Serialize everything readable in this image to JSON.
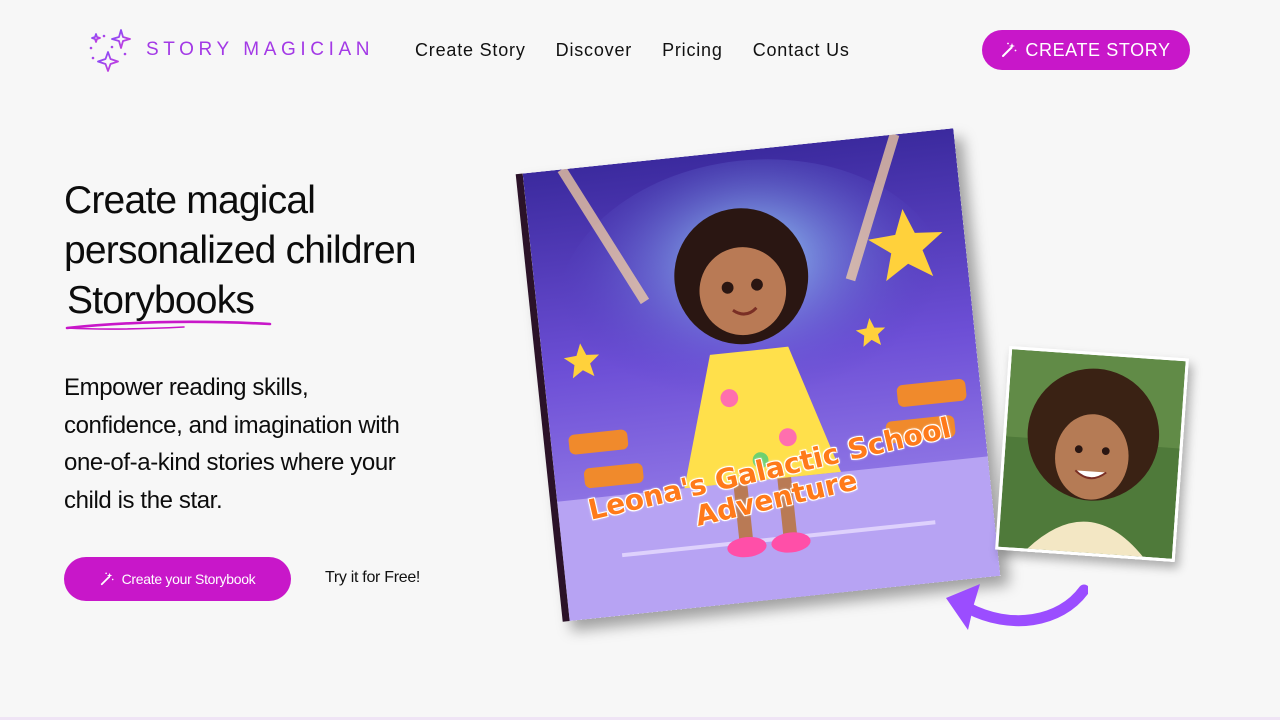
{
  "brand": {
    "name": "STORY MAGICIAN",
    "accent_color": "#c817c9",
    "logo_icon": "sparkles-icon"
  },
  "nav": {
    "items": [
      {
        "label": "Create Story"
      },
      {
        "label": "Discover"
      },
      {
        "label": "Pricing"
      },
      {
        "label": "Contact Us"
      }
    ],
    "cta_label": "CREATE STORY",
    "cta_icon": "magic-wand-icon"
  },
  "hero": {
    "title_line1": "Create magical",
    "title_line2": "personalized children",
    "title_highlight": "Storybooks",
    "subtitle": "Empower reading skills, confidence, and imagination with one-of-a-kind stories where your child is the star.",
    "cta_label": "Create your Storybook",
    "cta_icon": "magic-wand-icon",
    "secondary_label": "Try it for Free!"
  },
  "illustration": {
    "book_title": "Leona's Galactic School Adventure",
    "arrow_color": "#9b4dff"
  }
}
